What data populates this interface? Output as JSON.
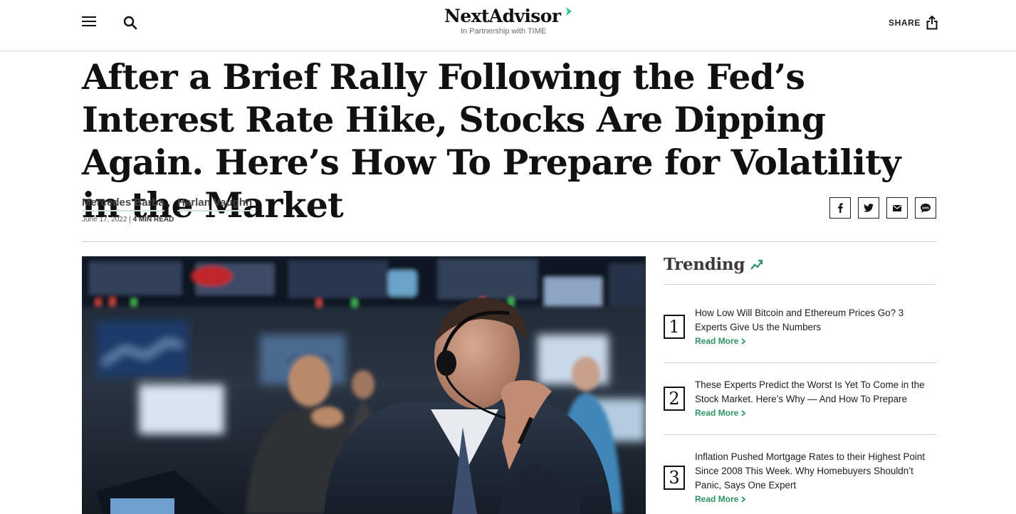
{
  "header": {
    "logo_text": "NextAdvisor",
    "logo_sub": "In Partnership with TIME",
    "share_label": "SHARE",
    "menu_icon": "hamburger-icon",
    "search_icon": "search-icon",
    "share_icon": "share-icon"
  },
  "article": {
    "headline": "After a Brief Rally Following the Fed’s Interest Rate Hike, Stocks Are Dipping Again. Here’s How To Prepare for Volatility in the Market",
    "authors": [
      "Mercedes Barba",
      "Harlan Vaughn"
    ],
    "author_separator": ",",
    "date": "June 17, 2022",
    "separator": "|",
    "read_time": "4 MIN READ"
  },
  "social": [
    {
      "name": "facebook",
      "icon": "facebook-icon"
    },
    {
      "name": "twitter",
      "icon": "twitter-icon"
    },
    {
      "name": "email",
      "icon": "email-icon"
    },
    {
      "name": "sms",
      "icon": "sms-icon"
    }
  ],
  "trending": {
    "title": "Trending",
    "icon": "trending-arrow-icon",
    "accent_color": "#2e9363",
    "items": [
      {
        "number": "1",
        "title": "How Low Will Bitcoin and Ethereum Prices Go? 3 Experts Give Us the Numbers",
        "cta": "Read More"
      },
      {
        "number": "2",
        "title": "These Experts Predict the Worst Is Yet To Come in the Stock Market. Here’s Why — And How To Prepare",
        "cta": "Read More"
      },
      {
        "number": "3",
        "title": "Inflation Pushed Mortgage Rates to their Highest Point Since 2008 This Week. Why Homebuyers Shouldn’t Panic, Says One Expert",
        "cta": "Read More"
      }
    ]
  }
}
